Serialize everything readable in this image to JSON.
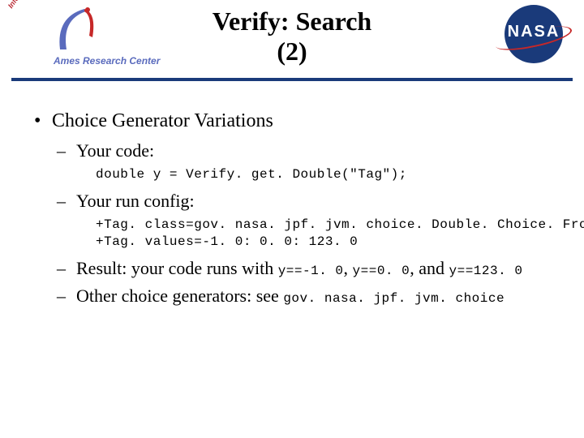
{
  "header": {
    "title_line1": "Verify: Search",
    "title_line2": "(2)",
    "arc_text": "Ames Research Center",
    "arc_badge": "Information Sciences & Technology",
    "nasa_word": "NASA"
  },
  "main": {
    "bullet1": "Choice Generator Variations",
    "sub1": {
      "label": "Your code:",
      "code": "double y = Verify. get. Double(\"Tag\");"
    },
    "sub2": {
      "label": "Your run config:",
      "code_line1": "+Tag. class=gov. nasa. jpf. jvm. choice. Double. Choice. From. Set",
      "code_line2": "+Tag. values=-1. 0: 0. 0: 123. 0"
    },
    "sub3": {
      "prefix": "Result: your code runs with ",
      "c1": "y==-1. 0",
      "sep1": ", ",
      "c2": "y==0. 0",
      "sep2": ", and ",
      "c3": "y==123. 0"
    },
    "sub4": {
      "prefix": "Other choice generators: see ",
      "code": "gov. nasa. jpf. jvm. choice"
    }
  }
}
